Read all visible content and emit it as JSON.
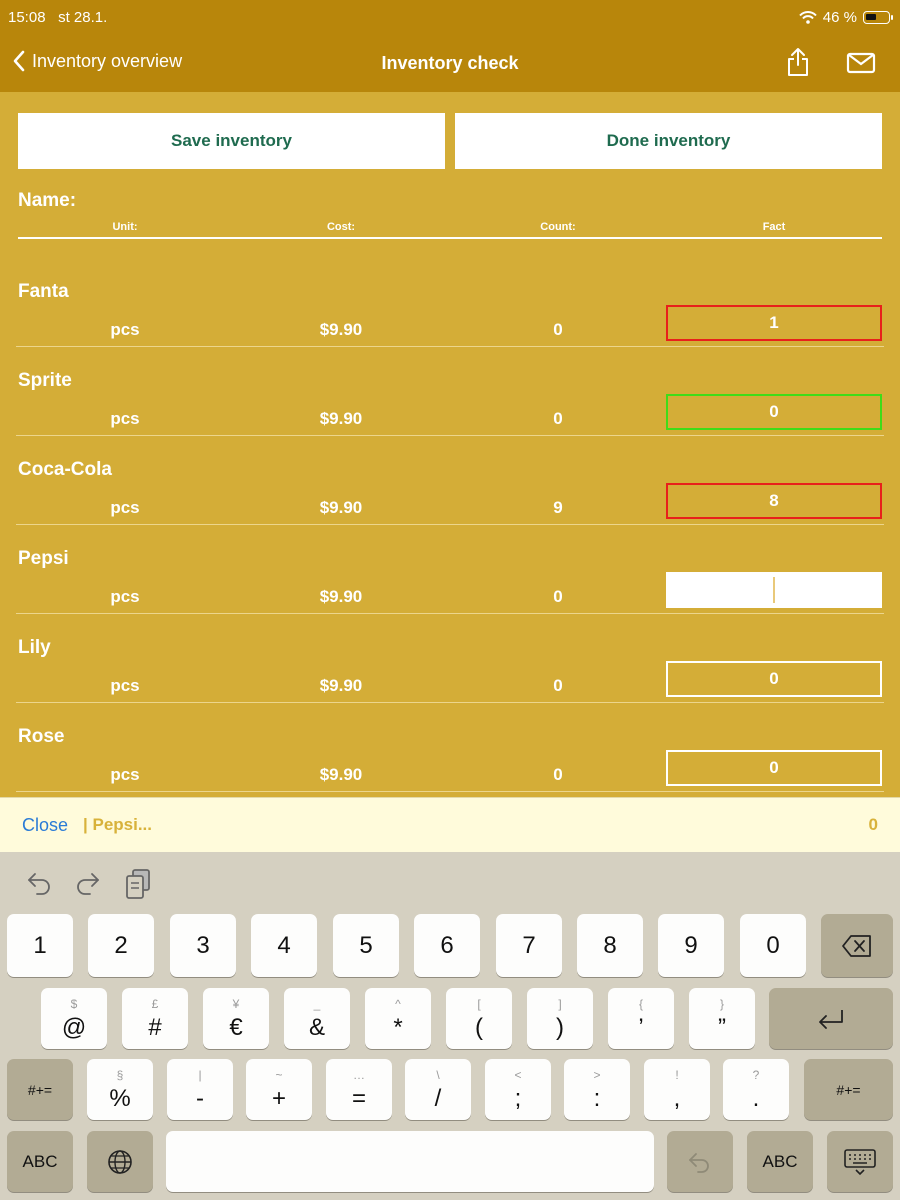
{
  "status": {
    "time": "15:08",
    "date": "st 28.1.",
    "battery": "46 %"
  },
  "nav": {
    "back_label": "Inventory overview",
    "title": "Inventory check"
  },
  "buttons": {
    "save": "Save inventory",
    "done": "Done inventory"
  },
  "header": {
    "name": "Name:",
    "unit": "Unit:",
    "cost": "Cost:",
    "count": "Count:",
    "fact": "Fact"
  },
  "rows": [
    {
      "name": "Fanta",
      "unit": "pcs",
      "cost": "$9.90",
      "count": "0",
      "fact": "1",
      "state": "red"
    },
    {
      "name": "Sprite",
      "unit": "pcs",
      "cost": "$9.90",
      "count": "0",
      "fact": "0",
      "state": "green"
    },
    {
      "name": "Coca-Cola",
      "unit": "pcs",
      "cost": "$9.90",
      "count": "9",
      "fact": "8",
      "state": "red"
    },
    {
      "name": "Pepsi",
      "unit": "pcs",
      "cost": "$9.90",
      "count": "0",
      "fact": "",
      "state": "active"
    },
    {
      "name": "Lily",
      "unit": "pcs",
      "cost": "$9.90",
      "count": "0",
      "fact": "0",
      "state": "normal"
    },
    {
      "name": "Rose",
      "unit": "pcs",
      "cost": "$9.90",
      "count": "0",
      "fact": "0",
      "state": "normal"
    }
  ],
  "accessory": {
    "close": "Close",
    "field": "| Pepsi...",
    "value": "0"
  },
  "keyboard": {
    "row1": [
      "1",
      "2",
      "3",
      "4",
      "5",
      "6",
      "7",
      "8",
      "9",
      "0"
    ],
    "row2": [
      {
        "main": "@",
        "sub": "$"
      },
      {
        "main": "#",
        "sub": "£"
      },
      {
        "main": "€",
        "sub": "¥"
      },
      {
        "main": "&",
        "sub": "_"
      },
      {
        "main": "*",
        "sub": "^"
      },
      {
        "main": "(",
        "sub": "["
      },
      {
        "main": ")",
        "sub": "]"
      },
      {
        "main": "’",
        "sub": "{"
      },
      {
        "main": "”",
        "sub": "}"
      }
    ],
    "row3": [
      {
        "main": "%",
        "sub": "§"
      },
      {
        "main": "-",
        "sub": "|"
      },
      {
        "main": "+",
        "sub": "~"
      },
      {
        "main": "=",
        "sub": "…"
      },
      {
        "main": "/",
        "sub": "\\"
      },
      {
        "main": ";",
        "sub": "<"
      },
      {
        "main": ":",
        "sub": ">"
      },
      {
        "main": ",",
        "sub": "!"
      },
      {
        "main": ".",
        "sub": "?"
      }
    ],
    "shift_label": "#+=",
    "abc_label": "ABC"
  },
  "colors": {
    "background": "#d4ad37",
    "nav_bar": "#b8860b",
    "button_text": "#1f6b4f",
    "mismatch_border": "#e8201b",
    "match_border": "#3fdc18",
    "link_blue": "#2a7bd6",
    "keyboard_bg": "#d5d0c1"
  },
  "icons": {
    "back": "chevron-left-icon",
    "share": "share-icon",
    "mail": "mail-icon",
    "wifi": "wifi-icon",
    "battery": "battery-icon",
    "undo": "undo-icon",
    "redo": "redo-icon",
    "paste": "paste-icon",
    "delete": "delete-icon",
    "return": "return-icon",
    "globe": "globe-icon",
    "keyboard_hide": "keyboard-hide-icon"
  }
}
